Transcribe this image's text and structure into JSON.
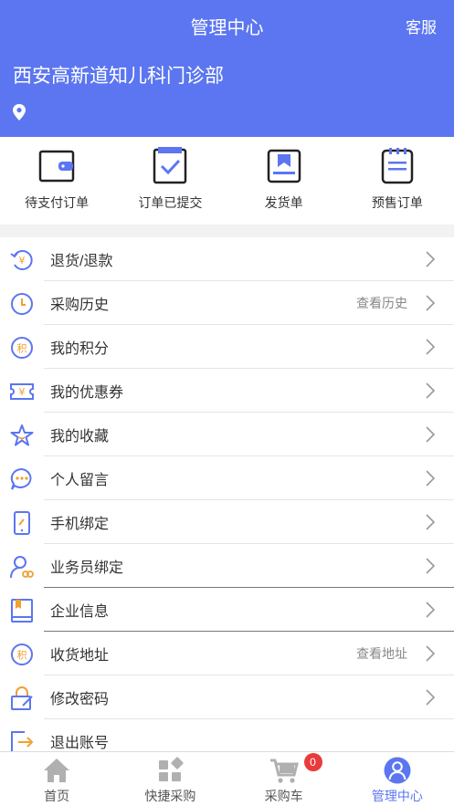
{
  "header": {
    "title": "管理中心",
    "service_label": "客服",
    "clinic_name": "西安高新道知儿科门诊部",
    "location_icon": "location-pin-icon"
  },
  "orders": [
    {
      "label": "待支付订单",
      "icon": "wallet-icon"
    },
    {
      "label": "订单已提交",
      "icon": "checklist-icon"
    },
    {
      "label": "发货单",
      "icon": "shipment-icon"
    },
    {
      "label": "预售订单",
      "icon": "presale-notepad-icon"
    }
  ],
  "menu": [
    {
      "label": "退货/退款",
      "extra": "",
      "icon": "refund-icon"
    },
    {
      "label": "采购历史",
      "extra": "查看历史",
      "icon": "clock-icon"
    },
    {
      "label": "我的积分",
      "extra": "",
      "icon": "points-icon"
    },
    {
      "label": "我的优惠券",
      "extra": "",
      "icon": "coupon-icon"
    },
    {
      "label": "我的收藏",
      "extra": "",
      "icon": "star-icon"
    },
    {
      "label": "个人留言",
      "extra": "",
      "icon": "message-icon"
    },
    {
      "label": "手机绑定",
      "extra": "",
      "icon": "phone-link-icon"
    },
    {
      "label": "业务员绑定",
      "extra": "",
      "icon": "salesperson-icon"
    },
    {
      "label": "企业信息",
      "extra": "",
      "icon": "book-icon"
    },
    {
      "label": "收货地址",
      "extra": "查看地址",
      "icon": "points-icon"
    },
    {
      "label": "修改密码",
      "extra": "",
      "icon": "lock-edit-icon"
    },
    {
      "label": "退出账号",
      "extra": "",
      "icon": "logout-icon"
    }
  ],
  "tabbar": [
    {
      "label": "首页",
      "icon": "home-icon"
    },
    {
      "label": "快捷采购",
      "icon": "grid-icon"
    },
    {
      "label": "采购车",
      "icon": "cart-icon",
      "badge": "0"
    },
    {
      "label": "管理中心",
      "icon": "user-icon",
      "active": true
    }
  ],
  "colors": {
    "primary": "#5b76f0",
    "orange": "#f0a030",
    "badge": "#e83b3b"
  }
}
